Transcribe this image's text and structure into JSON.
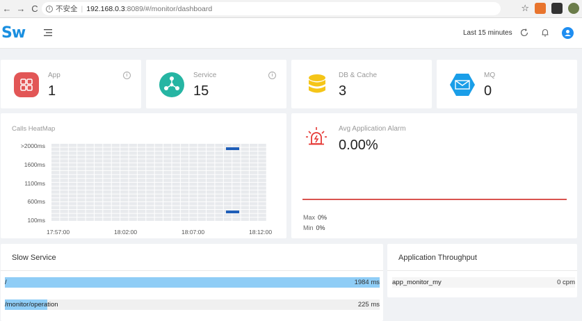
{
  "browser": {
    "security_label": "不安全",
    "url_host": "192.168.0.3",
    "url_rest": ":8089/#/monitor/dashboard"
  },
  "header": {
    "logo": "Sw",
    "time_range": "Last 15 minutes",
    "brand_color": "#1a8fe0"
  },
  "stats": [
    {
      "label": "App",
      "value": "1",
      "icon": "apps-grid-icon",
      "color": "#e25656"
    },
    {
      "label": "Service",
      "value": "15",
      "icon": "service-nodes-icon",
      "color": "#26b5a3"
    },
    {
      "label": "DB & Cache",
      "value": "3",
      "icon": "database-icon",
      "color": "#f5c518"
    },
    {
      "label": "MQ",
      "value": "0",
      "icon": "message-queue-icon",
      "color": "#1a9ee8"
    }
  ],
  "heatmap": {
    "title": "Calls HeatMap",
    "y_labels": [
      ">2000ms",
      "1600ms",
      "1100ms",
      "600ms",
      "100ms"
    ],
    "x_labels": [
      "17:57:00",
      "18:02:00",
      "18:07:00",
      "18:12:00"
    ],
    "cell_color": "#1f5eb8"
  },
  "alarm": {
    "label": "Avg Application Alarm",
    "value": "0.00%",
    "max_label": "Max",
    "max_value": "0%",
    "min_label": "Min",
    "min_value": "0%",
    "line_color": "#d9534f"
  },
  "slow_service": {
    "title": "Slow Service",
    "rows": [
      {
        "name": "/",
        "value": "1984 ms",
        "ms": 1984
      },
      {
        "name": "/monitor/operation",
        "value": "225 ms",
        "ms": 225
      }
    ],
    "bar_color": "#8fcdf6"
  },
  "throughput": {
    "title": "Application Throughput",
    "rows": [
      {
        "name": "app_monitor_my",
        "value": "0 cpm"
      }
    ]
  }
}
